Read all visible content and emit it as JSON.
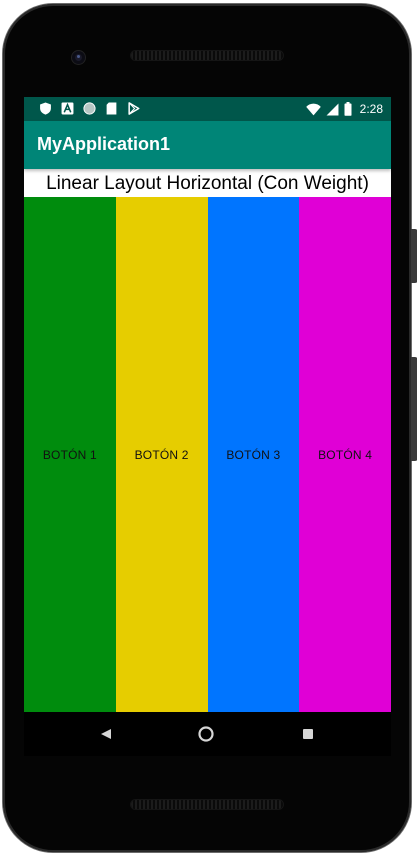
{
  "status_bar": {
    "time": "2:28",
    "left_icons": [
      "shield-icon",
      "font-a-icon",
      "circle-icon",
      "sd-card-icon",
      "play-store-icon"
    ],
    "right_icons": [
      "wifi-icon",
      "signal-icon",
      "battery-icon"
    ]
  },
  "app_bar": {
    "title": "MyApplication1",
    "color": "#008577",
    "status_color": "#00574b"
  },
  "main": {
    "heading": "Linear Layout Horizontal (Con Weight)",
    "buttons": [
      {
        "label": "BOTÓN 1",
        "color": "#008c0d"
      },
      {
        "label": "BOTÓN 2",
        "color": "#e6cd00"
      },
      {
        "label": "BOTÓN 3",
        "color": "#0075ff"
      },
      {
        "label": "BOTÓN 4",
        "color": "#e000d6"
      }
    ]
  },
  "nav_bar": {
    "icons": [
      "back-icon",
      "home-icon",
      "recents-icon"
    ]
  }
}
